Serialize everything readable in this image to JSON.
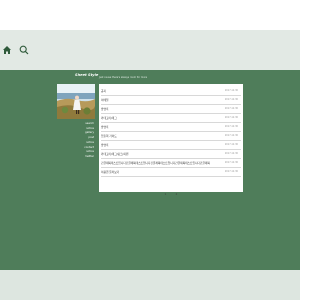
{
  "header": {
    "home_icon": "home-icon",
    "search_icon": "search-icon"
  },
  "blog": {
    "title": "Sheet Style",
    "subtitle": "Just cause there's always room for more"
  },
  "sidebar": {
    "items": [
      "search",
      "notice",
      "gallery",
      "post",
      "notice",
      "contact",
      "notice",
      "twitter"
    ]
  },
  "posts": [
    {
      "title": "공지",
      "date": "2017.12.30"
    },
    {
      "title": "이메일",
      "date": "2017.12.30"
    },
    {
      "title": "방명록",
      "date": "2017.12.30"
    },
    {
      "title": "카테고리/태그",
      "date": "2017.12.30"
    },
    {
      "title": "방명록",
      "date": "2017.12.30"
    },
    {
      "title": "입출력 가이드",
      "date": "2017.12.30"
    },
    {
      "title": "방명록",
      "date": "2017.12.30"
    },
    {
      "title": "카테고리/태그/링크/지원",
      "date": "2017.12.30"
    },
    {
      "title": "긴글제목테스트입니다긴글제목테스트입니다긴글제목테스트입니다긴글제목테스트입니다긴글제목",
      "date": "2017.12.30"
    },
    {
      "title": "이용권 둘러보기",
      "date": "2017.12.30"
    }
  ],
  "pagination": {
    "pages": [
      "1",
      "2"
    ]
  },
  "colors": {
    "main_bg": "#4f7d5a",
    "nav_bg": "#e2e9e4",
    "panel_bg": "#ffffff",
    "footer_bg": "#dde6e0"
  }
}
